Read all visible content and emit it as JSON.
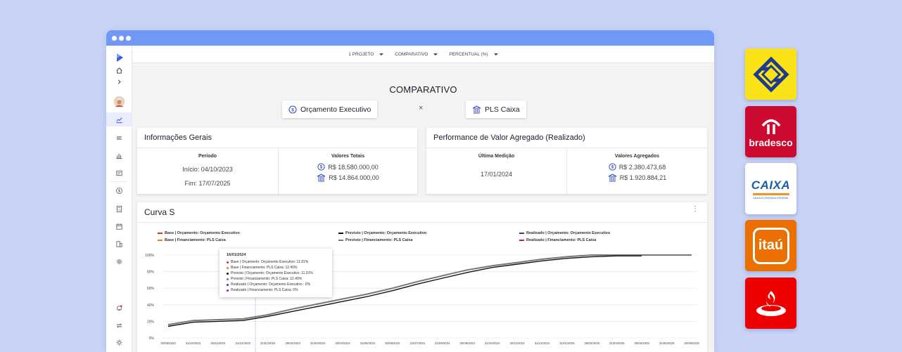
{
  "topbar": {
    "items": [
      {
        "label": "1 PROJETO"
      },
      {
        "label": "COMPARATIVO"
      },
      {
        "label": "PERCENTUAL (%)"
      }
    ]
  },
  "comparison": {
    "title": "COMPARATIVO",
    "left_label": "Orçamento Executivo",
    "right_label": "PLS Caixa",
    "separator": "×"
  },
  "general_info": {
    "title": "Informações Gerais",
    "period_header": "Período",
    "start": "Início: 04/10/2023",
    "end": "Fim: 17/07/2025",
    "totals_header": "Valores Totais",
    "total_budget": "R$ 18.580.000,00",
    "total_financing": "R$ 14.864.000,00"
  },
  "performance": {
    "title": "Performance de Valor Agregado (Realizado)",
    "last_header": "Última Medição",
    "last_date": "17/01/2024",
    "aggregated_header": "Valores Agregados",
    "agg_budget": "R$ 2.380.473,68",
    "agg_financing": "R$ 1.920.884,21"
  },
  "curve": {
    "title": "Curva S",
    "legend": [
      {
        "label": "Base | Orçamento: Orçamento Executivo",
        "color": "#c0392b"
      },
      {
        "label": "Base | Financiamento: PLS Caixa",
        "color": "#e67e22"
      },
      {
        "label": "Previsto | Orçamento: Orçamento Executivo",
        "color": "#111111"
      },
      {
        "label": "Previsto | Financiamento: PLS Caixa",
        "color": "#777777"
      },
      {
        "label": "Realizado | Orçamento: Orçamento Executivo",
        "color": "#2c3e8f"
      },
      {
        "label": "Realizado | Financiamento: PLS Caixa",
        "color": "#c2185b"
      }
    ],
    "tooltip": {
      "date": "16/01/2024",
      "rows": [
        {
          "text": "Base | Orçamento: Orçamento Executivo: 11.91%",
          "color": "#c0392b"
        },
        {
          "text": "Base | Financiamento: PLS Caixa: 12.40%",
          "color": "#e67e22"
        },
        {
          "text": "Previsto | Orçamento: Orçamento Executivo: 11.91%",
          "color": "#111111"
        },
        {
          "text": "Previsto | Financiamento: PLS Caixa: 12.40%",
          "color": "#777777"
        },
        {
          "text": "Realizado | Orçamento: Orçamento Executivo : 0%",
          "color": "#2c3e8f"
        },
        {
          "text": "Realizado | Financiamento: PLS Caixa: 0%",
          "color": "#c2185b"
        }
      ]
    }
  },
  "chart_data": {
    "type": "line",
    "y_ticks": [
      "0%",
      "20%",
      "40%",
      "60%",
      "80%",
      "100%"
    ],
    "ylim": [
      0,
      100
    ],
    "x_labels": [
      "30/09/2023",
      "31/10/2023",
      "30/11/2023",
      "31/12/2023",
      "31/01/2024",
      "29/02/2024",
      "31/03/2024",
      "30/04/2024",
      "31/05/2024",
      "30/06/2024",
      "31/07/2024",
      "31/08/2024",
      "30/09/2024",
      "31/10/2024",
      "30/11/2024",
      "31/12/2024",
      "31/01/2025",
      "28/02/2025",
      "31/03/2025",
      "30/04/2025",
      "31/05/2025",
      "30/06/2025"
    ],
    "grid": true,
    "series": [
      {
        "name": "Previsto | Orçamento: Orçamento Executivo",
        "color": "#111111",
        "x_index": [
          0,
          1,
          2,
          3,
          4,
          5,
          6,
          7,
          8,
          9,
          10,
          11,
          12,
          13,
          14,
          15,
          16,
          17,
          18,
          19
        ],
        "values": [
          14,
          19,
          20,
          21,
          26,
          32,
          38,
          44,
          50,
          57,
          65,
          72,
          79,
          85,
          89,
          93,
          96,
          98,
          99,
          99
        ]
      },
      {
        "name": "Previsto | Financiamento: PLS Caixa",
        "color": "#777777",
        "x_index": [
          0,
          1,
          2,
          3,
          4,
          5,
          6,
          7,
          8,
          9,
          10,
          11,
          12,
          13,
          14,
          15,
          16,
          17,
          18,
          19,
          20,
          21
        ],
        "values": [
          16,
          21,
          22,
          23,
          28,
          35,
          41,
          47,
          53,
          60,
          68,
          75,
          82,
          87,
          91,
          95,
          98,
          100,
          100,
          100,
          100,
          100
        ]
      }
    ]
  },
  "banks": [
    {
      "name": "Banco do Brasil",
      "color": "#fbe216"
    },
    {
      "name": "bradesco",
      "color": "#cc092f"
    },
    {
      "name": "CAIXA",
      "subtitle": "CAIXA ECONÔMICA FEDERAL",
      "color": "#ffffff"
    },
    {
      "name": "itaú",
      "color": "#ec7000"
    },
    {
      "name": "Santander",
      "color": "#ec0000"
    }
  ]
}
